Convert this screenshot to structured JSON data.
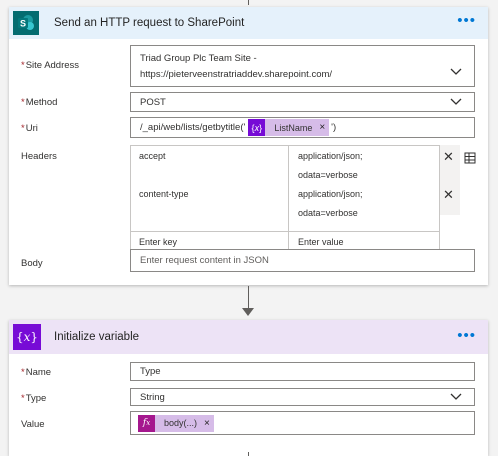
{
  "sharepoint_card": {
    "title": "Send an HTTP request to SharePoint",
    "more": "•••",
    "site_address_label": "Site Address",
    "site_address_line1": "Triad Group Plc Team Site -",
    "site_address_line2": "https://pieterveenstratriaddev.sharepoint.com/",
    "method_label": "Method",
    "method_value": "POST",
    "uri_label": "Uri",
    "uri_prefix": "/_api/web/lists/getbytitle('",
    "uri_token": "ListName",
    "uri_suffix": "')",
    "headers_label": "Headers",
    "headers": [
      {
        "key": "accept",
        "value_line1": "application/json;",
        "value_line2": "odata=verbose"
      },
      {
        "key": "content-type",
        "value_line1": "application/json;",
        "value_line2": "odata=verbose"
      }
    ],
    "key_placeholder": "Enter key",
    "value_placeholder": "Enter value",
    "body_label": "Body",
    "body_placeholder": "Enter request content in JSON",
    "required_mark": "*",
    "token_remove": "×",
    "remove_symbol": "✕"
  },
  "variable_card": {
    "title": "Initialize variable",
    "more": "•••",
    "name_label": "Name",
    "name_value": "Type",
    "type_label": "Type",
    "type_value": "String",
    "value_label": "Value",
    "value_token": "body(...)",
    "required_mark": "*",
    "token_remove": "×"
  },
  "colors": {
    "sharepoint_header": "#e5f1fb",
    "sharepoint_icon": "#036c70",
    "variable_header": "#ede3f6",
    "variable_icon": "#770bd6",
    "expression_icon": "#a5178e",
    "dynamic_icon": "#770bd6",
    "token_bg": "#d6bce8",
    "accent": "#0078d4"
  },
  "icons": {
    "sharepoint": "sharepoint-icon",
    "variable": "variable-icon",
    "expression": "fx-icon",
    "dynamic_content": "dynamic-content-icon",
    "switch_to_text": "switch-text-mode-icon"
  }
}
